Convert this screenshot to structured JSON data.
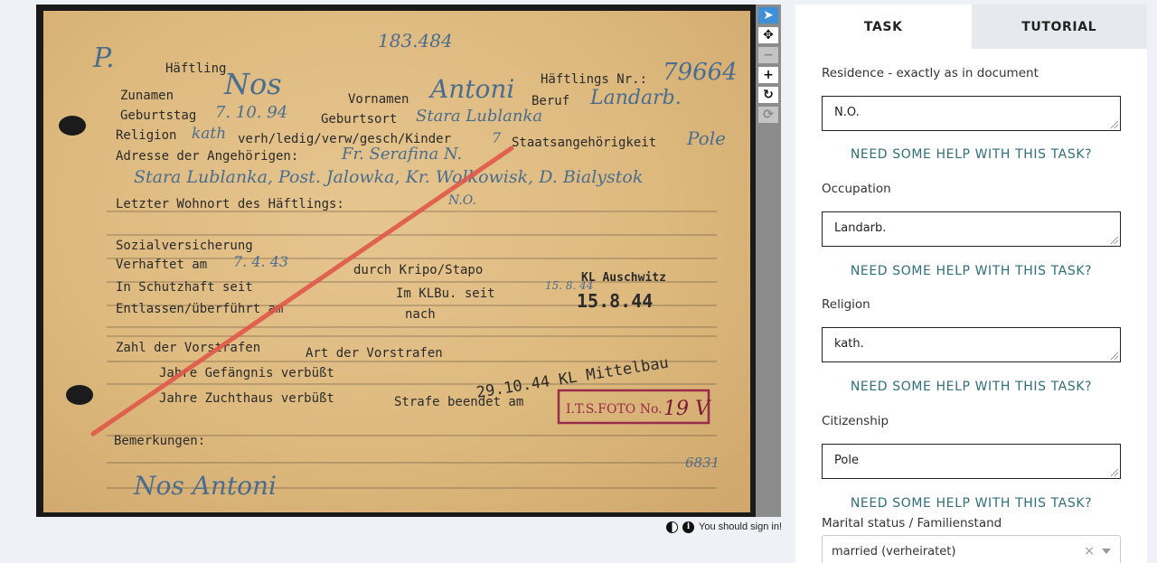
{
  "document": {
    "top_number": "183.484",
    "prefix_mark": "P.",
    "fields": {
      "haeftling_label": "Häftling",
      "haeftlings_nr_label": "Häftlings Nr.:",
      "zuname_label": "Zunamen",
      "vorname_label": "Vornamen",
      "beruf_label": "Beruf",
      "geburtstag_label": "Geburtstag",
      "geburtsort_label": "Geburtsort",
      "religion_label": "Religion",
      "family_status_label": "verh/ledig/verw/gesch/Kinder",
      "staatsangehoerigkeit_label": "Staatsangehörigkeit",
      "adresse_label": "Adresse der Angehörigen:",
      "letzter_wohnort_label": "Letzter Wohnort des Häftlings:",
      "sozialversicherung_label": "Sozialversicherung",
      "verhaftet_label": "Verhaftet am",
      "durch_label": "durch Kripo/Stapo",
      "schutzhaft_label": "In Schutzhaft seit",
      "im_klbu_label": "Im KLBu. seit",
      "entlassen_label": "Entlassen/überführt am",
      "nach_label": "nach",
      "vorstrafen_label": "Zahl der Vorstrafen",
      "art_vorstrafen_label": "Art der Vorstrafen",
      "gefaengnis_label": "Jahre Gefängnis verbüßt",
      "zuchthaus_label": "Jahre Zuchthaus verbüßt",
      "strafe_label": "Strafe beendet am",
      "bemerkungen_label": "Bemerkungen:"
    },
    "handwritten": {
      "surname": "Nos",
      "first_name": "Antoni",
      "prisoner_nr": "79664",
      "occupation": "Landarb.",
      "birth_date": "7. 10. 94",
      "birth_place": "Stara Lublanka",
      "religion": "kath",
      "children": "7",
      "citizenship": "Pole",
      "relative": "Fr. Serafina N.",
      "address_line": "Stara Lublanka, Post. Jalowka, Kr. Wolkowisk, D. Bialystok",
      "residence": "N.O.",
      "arrest_date": "7. 4. 43",
      "klbu_date": "15. 8. 44",
      "signature": "Nos Antoni",
      "ref_number": "6831"
    },
    "stamps": {
      "kl_auschwitz": "KL Auschwitz",
      "auschwitz_date": "15.8.44",
      "mittelbau": "29.10.44 KL Mittelbau",
      "its_foto": "I.T.S.FOTO No.",
      "its_number": "19 V"
    }
  },
  "viewer_tools": [
    {
      "name": "pointer-tool",
      "glyph": "➤"
    },
    {
      "name": "move-tool",
      "glyph": "✥"
    },
    {
      "name": "zoom-out-tool",
      "glyph": "−"
    },
    {
      "name": "zoom-in-tool",
      "glyph": "+"
    },
    {
      "name": "rotate-tool",
      "glyph": "↻"
    },
    {
      "name": "reset-tool",
      "glyph": "⟳"
    }
  ],
  "signin_notice": "You should sign in!",
  "panel": {
    "tabs": [
      {
        "label": "TASK"
      },
      {
        "label": "TUTORIAL"
      }
    ],
    "fields": [
      {
        "label": "Residence - exactly as in document",
        "value": "N.O."
      },
      {
        "label": "Occupation",
        "value": "Landarb."
      },
      {
        "label": "Religion",
        "value": "kath."
      },
      {
        "label": "Citizenship",
        "value": "Pole"
      }
    ],
    "help_link": "NEED SOME HELP WITH THIS TASK?",
    "marital": {
      "label": "Marital status / Familienstand",
      "value": "married (verheiratet)",
      "clear": "×"
    }
  },
  "colors": {
    "accent": "#3d8fd8",
    "link": "#2f6f78",
    "card": "#ddb97e",
    "stamp_red": "#9a2a4a",
    "red_line": "#e0584a"
  }
}
